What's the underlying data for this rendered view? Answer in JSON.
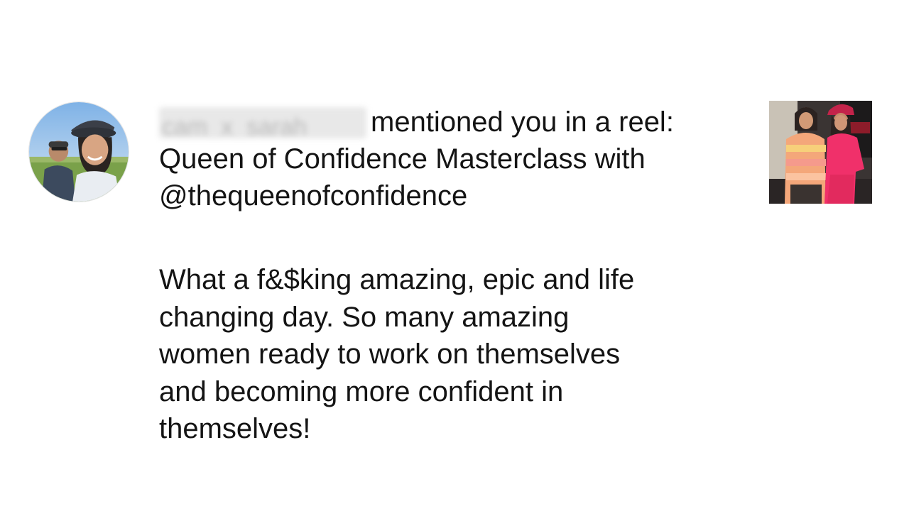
{
  "notification": {
    "username": "cam_x_sarah",
    "action_text": "mentioned you in a reel:",
    "reel_title": "Queen of Confidence Masterclass with",
    "mention": "@thequeenofconfidence",
    "caption_lines": [
      "What a f&$king amazing, epic and life",
      "changing day. So many amazing",
      "women ready to work on themselves",
      "and becoming more confident in",
      "themselves!"
    ]
  },
  "colors": {
    "background": "#ffffff",
    "text": "#141414",
    "blur": "#e8e8e8"
  },
  "icons": {
    "avatar": "profile-avatar-photo",
    "thumbnail": "reel-thumbnail-photo"
  }
}
